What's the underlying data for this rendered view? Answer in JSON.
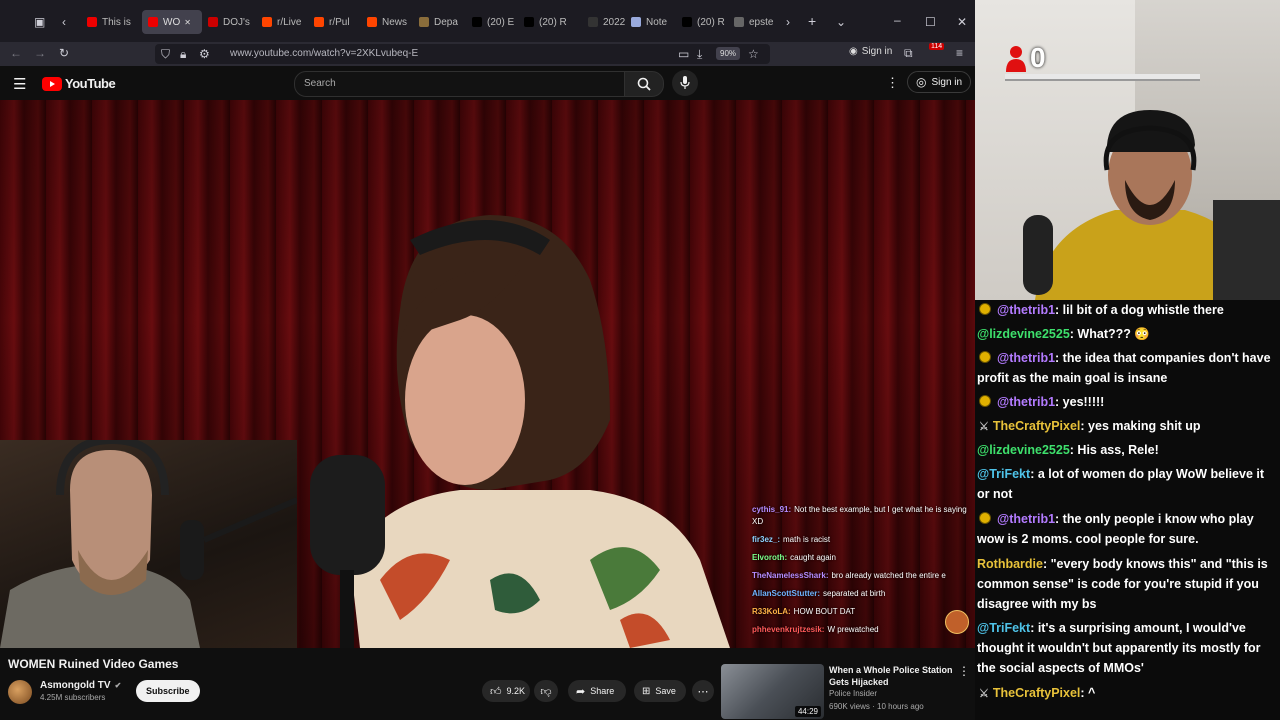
{
  "browser": {
    "tabs": [
      {
        "label": "This is"
      },
      {
        "label": "WO"
      },
      {
        "label": "DOJ's"
      },
      {
        "label": "r/Live"
      },
      {
        "label": "r/Pul"
      },
      {
        "label": "News"
      },
      {
        "label": "Depa"
      },
      {
        "label": "(20) E"
      },
      {
        "label": "(20) R"
      },
      {
        "label": "2022"
      },
      {
        "label": "Note"
      },
      {
        "label": "(20) R"
      },
      {
        "label": "epste"
      }
    ],
    "url": "www.youtube.com/watch?v=2XKLvubeq-E",
    "zoom": "90%",
    "signin_label": "Sign in",
    "extension_count": "114"
  },
  "youtube": {
    "logo_text": "YouTube",
    "search_placeholder": "Search",
    "signin_label": "Sign in",
    "video": {
      "title": "WOMEN Ruined Video Games",
      "channel": "Asmongold TV",
      "subscribers": "4.25M subscribers",
      "subscribe_label": "Subscribe",
      "likes": "9.2K",
      "share_label": "Share",
      "save_label": "Save",
      "overlay_chat": [
        {
          "user": "cythis_91:",
          "text": "Not the best example, but I get what he is saying XD",
          "color": "#b68cff"
        },
        {
          "user": "fir3ez_:",
          "text": "math is racist",
          "color": "#8fd3ff"
        },
        {
          "user": "Elvoroth:",
          "text": "caught again",
          "color": "#7dff8a"
        },
        {
          "user": "TheNamelessShark:",
          "text": "bro already watched the entire e",
          "color": "#b68cff"
        },
        {
          "user": "AllanScottStutter:",
          "text": "separated at birth",
          "color": "#6fb3ff"
        },
        {
          "user": "R33KoLA:",
          "text": "HOW BOUT DAT",
          "color": "#ffb347"
        },
        {
          "user": "phhevenkrujtzesik:",
          "text": "W prewatched",
          "color": "#ff5a5a"
        }
      ]
    },
    "recommendation": {
      "title": "When a Whole Police Station Gets Hijacked",
      "channel": "Police Insider",
      "meta": "690K views · 10 hours ago",
      "duration": "44:29"
    }
  },
  "stream": {
    "counter": "0",
    "chat": [
      {
        "badge": "dot",
        "user": "@thetrib1",
        "text": ": lil bit of a dog whistle there",
        "color": "#b37bff"
      },
      {
        "badge": "",
        "user": "@lizdevine2525",
        "text": ": What??? 😳",
        "color": "#3ee06c"
      },
      {
        "badge": "dot",
        "user": "@thetrib1",
        "text": ": the idea that companies don't have profit as the main goal is insane",
        "color": "#b37bff"
      },
      {
        "badge": "dot",
        "user": "@thetrib1",
        "text": ": yes!!!!!",
        "color": "#b37bff"
      },
      {
        "badge": "glyph",
        "user": "TheCraftyPixel",
        "text": ": yes making shit up",
        "color": "#e8c23a"
      },
      {
        "badge": "",
        "user": "@lizdevine2525",
        "text": ": His ass, Rele!",
        "color": "#3ee06c"
      },
      {
        "badge": "",
        "user": "@TriFekt",
        "text": ": a lot of women do play WoW believe it or not",
        "color": "#4fc3e8"
      },
      {
        "badge": "dot",
        "user": "@thetrib1",
        "text": ": the only people i know who play wow is 2 moms. cool people for sure.",
        "color": "#b37bff"
      },
      {
        "badge": "",
        "user": "Rothbardie",
        "text": ": \"every body knows this\" and \"this is common sense\" is code for you're stupid if you disagree with my bs",
        "color": "#e8c23a"
      },
      {
        "badge": "",
        "user": "@TriFekt",
        "text": ": it's a surprising amount, I would've thought it wouldn't but apparently its mostly for the social aspects of MMOs'",
        "color": "#4fc3e8"
      },
      {
        "badge": "glyph",
        "user": "TheCraftyPixel",
        "text": ": ^",
        "color": "#e8c23a"
      }
    ]
  },
  "colors": {
    "yt_red": "#ff0000",
    "browser_bg": "#1c1b22",
    "chat_bg": "#0b0b0b"
  }
}
